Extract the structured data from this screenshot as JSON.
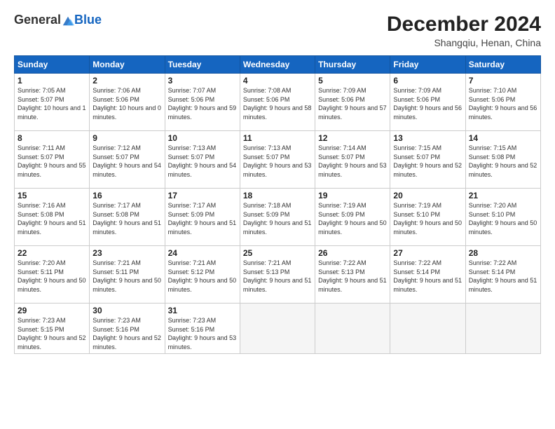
{
  "logo": {
    "general": "General",
    "blue": "Blue"
  },
  "title": "December 2024",
  "location": "Shangqiu, Henan, China",
  "weekdays": [
    "Sunday",
    "Monday",
    "Tuesday",
    "Wednesday",
    "Thursday",
    "Friday",
    "Saturday"
  ],
  "weeks": [
    [
      {
        "day": "1",
        "sunrise": "7:05 AM",
        "sunset": "5:07 PM",
        "daylight": "10 hours and 1 minute."
      },
      {
        "day": "2",
        "sunrise": "7:06 AM",
        "sunset": "5:06 PM",
        "daylight": "10 hours and 0 minutes."
      },
      {
        "day": "3",
        "sunrise": "7:07 AM",
        "sunset": "5:06 PM",
        "daylight": "9 hours and 59 minutes."
      },
      {
        "day": "4",
        "sunrise": "7:08 AM",
        "sunset": "5:06 PM",
        "daylight": "9 hours and 58 minutes."
      },
      {
        "day": "5",
        "sunrise": "7:09 AM",
        "sunset": "5:06 PM",
        "daylight": "9 hours and 57 minutes."
      },
      {
        "day": "6",
        "sunrise": "7:09 AM",
        "sunset": "5:06 PM",
        "daylight": "9 hours and 56 minutes."
      },
      {
        "day": "7",
        "sunrise": "7:10 AM",
        "sunset": "5:06 PM",
        "daylight": "9 hours and 56 minutes."
      }
    ],
    [
      {
        "day": "8",
        "sunrise": "7:11 AM",
        "sunset": "5:07 PM",
        "daylight": "9 hours and 55 minutes."
      },
      {
        "day": "9",
        "sunrise": "7:12 AM",
        "sunset": "5:07 PM",
        "daylight": "9 hours and 54 minutes."
      },
      {
        "day": "10",
        "sunrise": "7:13 AM",
        "sunset": "5:07 PM",
        "daylight": "9 hours and 54 minutes."
      },
      {
        "day": "11",
        "sunrise": "7:13 AM",
        "sunset": "5:07 PM",
        "daylight": "9 hours and 53 minutes."
      },
      {
        "day": "12",
        "sunrise": "7:14 AM",
        "sunset": "5:07 PM",
        "daylight": "9 hours and 53 minutes."
      },
      {
        "day": "13",
        "sunrise": "7:15 AM",
        "sunset": "5:07 PM",
        "daylight": "9 hours and 52 minutes."
      },
      {
        "day": "14",
        "sunrise": "7:15 AM",
        "sunset": "5:08 PM",
        "daylight": "9 hours and 52 minutes."
      }
    ],
    [
      {
        "day": "15",
        "sunrise": "7:16 AM",
        "sunset": "5:08 PM",
        "daylight": "9 hours and 51 minutes."
      },
      {
        "day": "16",
        "sunrise": "7:17 AM",
        "sunset": "5:08 PM",
        "daylight": "9 hours and 51 minutes."
      },
      {
        "day": "17",
        "sunrise": "7:17 AM",
        "sunset": "5:09 PM",
        "daylight": "9 hours and 51 minutes."
      },
      {
        "day": "18",
        "sunrise": "7:18 AM",
        "sunset": "5:09 PM",
        "daylight": "9 hours and 51 minutes."
      },
      {
        "day": "19",
        "sunrise": "7:19 AM",
        "sunset": "5:09 PM",
        "daylight": "9 hours and 50 minutes."
      },
      {
        "day": "20",
        "sunrise": "7:19 AM",
        "sunset": "5:10 PM",
        "daylight": "9 hours and 50 minutes."
      },
      {
        "day": "21",
        "sunrise": "7:20 AM",
        "sunset": "5:10 PM",
        "daylight": "9 hours and 50 minutes."
      }
    ],
    [
      {
        "day": "22",
        "sunrise": "7:20 AM",
        "sunset": "5:11 PM",
        "daylight": "9 hours and 50 minutes."
      },
      {
        "day": "23",
        "sunrise": "7:21 AM",
        "sunset": "5:11 PM",
        "daylight": "9 hours and 50 minutes."
      },
      {
        "day": "24",
        "sunrise": "7:21 AM",
        "sunset": "5:12 PM",
        "daylight": "9 hours and 50 minutes."
      },
      {
        "day": "25",
        "sunrise": "7:21 AM",
        "sunset": "5:13 PM",
        "daylight": "9 hours and 51 minutes."
      },
      {
        "day": "26",
        "sunrise": "7:22 AM",
        "sunset": "5:13 PM",
        "daylight": "9 hours and 51 minutes."
      },
      {
        "day": "27",
        "sunrise": "7:22 AM",
        "sunset": "5:14 PM",
        "daylight": "9 hours and 51 minutes."
      },
      {
        "day": "28",
        "sunrise": "7:22 AM",
        "sunset": "5:14 PM",
        "daylight": "9 hours and 51 minutes."
      }
    ],
    [
      {
        "day": "29",
        "sunrise": "7:23 AM",
        "sunset": "5:15 PM",
        "daylight": "9 hours and 52 minutes."
      },
      {
        "day": "30",
        "sunrise": "7:23 AM",
        "sunset": "5:16 PM",
        "daylight": "9 hours and 52 minutes."
      },
      {
        "day": "31",
        "sunrise": "7:23 AM",
        "sunset": "5:16 PM",
        "daylight": "9 hours and 53 minutes."
      },
      null,
      null,
      null,
      null
    ]
  ]
}
